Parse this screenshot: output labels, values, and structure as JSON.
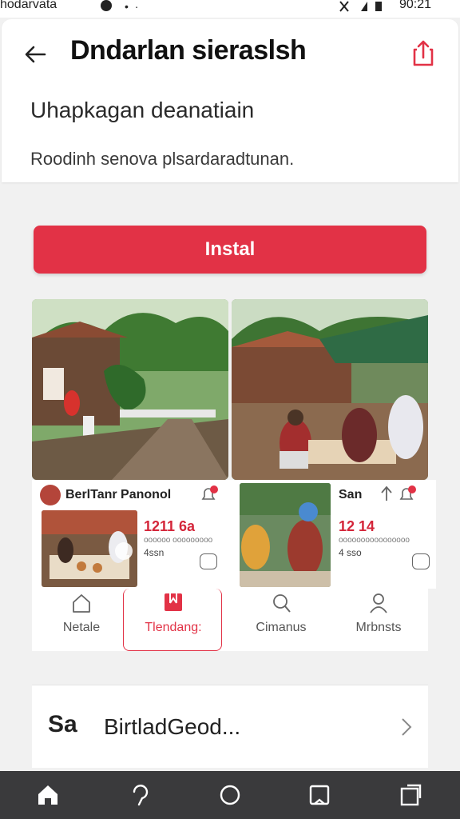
{
  "status_bar": {
    "carrier": "hodarvata",
    "time": "90:21"
  },
  "header": {
    "title": "Dndarlan sieraslsh",
    "subtitle": "Uhapkagan deanatiain",
    "description": "Roodinh senova plsardaradtunan."
  },
  "install_button": {
    "label": "Instal"
  },
  "cards": [
    {
      "title": "BerlTanr Panonol",
      "price": "1211 6a",
      "meta": "oooooo ooooooooo",
      "count": "4ssn"
    },
    {
      "title": "San",
      "price": "12 14",
      "meta": "oooooooooooooooo",
      "count": "4 sso"
    }
  ],
  "tabs": [
    {
      "label": "Netale",
      "icon": "home-outline-icon",
      "active": false
    },
    {
      "label": "Tlendang:",
      "icon": "gift-icon",
      "active": true
    },
    {
      "label": "Cimanus",
      "icon": "search-icon",
      "active": false
    },
    {
      "label": "Mrbnsts",
      "icon": "profile-icon",
      "active": false
    }
  ],
  "promo": {
    "logo": "Sa",
    "text": "BirtladGeod..."
  },
  "colors": {
    "accent": "#e23246",
    "nav_bg": "#3a3a3c"
  }
}
